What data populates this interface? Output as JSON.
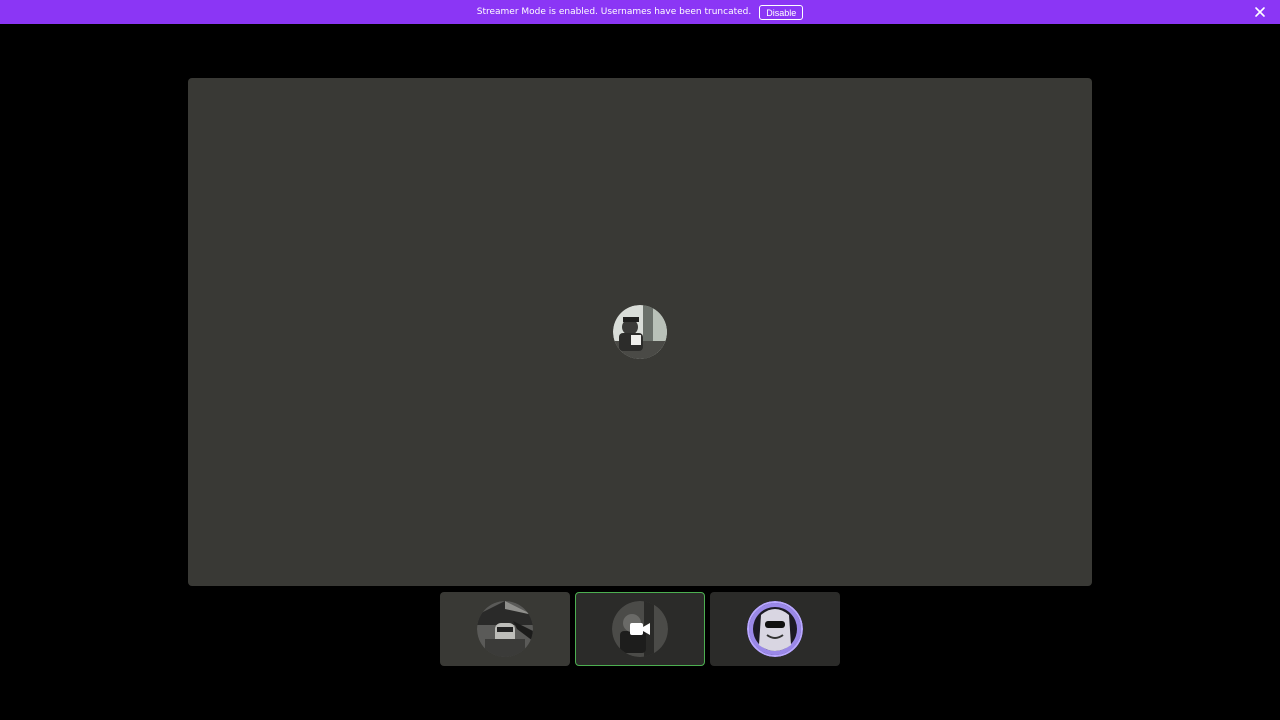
{
  "banner": {
    "message": "Streamer Mode is enabled. Usernames have been truncated.",
    "disable_label": "Disable",
    "color": "#8b36f5"
  },
  "icons": {
    "close": "close-icon",
    "camera": "video-camera-icon"
  },
  "stage": {
    "background": "#393935",
    "focused_participant_avatar": "avatar-image"
  },
  "participants": [
    {
      "avatar": "avatar-image",
      "selected": false
    },
    {
      "avatar": "avatar-image",
      "selected": true,
      "camera_icon": true
    },
    {
      "avatar": "avatar-image",
      "selected": false
    }
  ],
  "selection_color": "#4caf50"
}
